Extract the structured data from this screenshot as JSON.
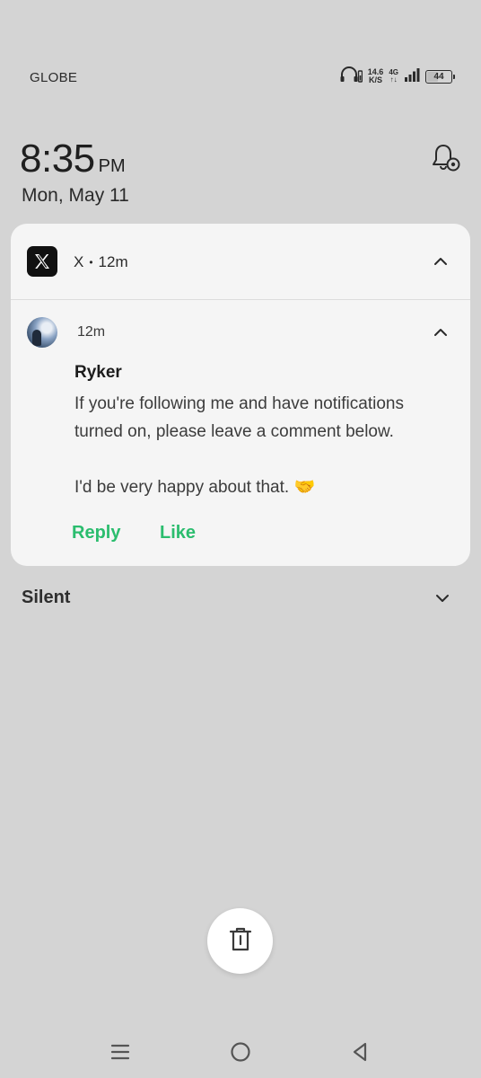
{
  "status_bar": {
    "carrier": "GLOBE",
    "net_speed_value": "14.6",
    "net_speed_unit": "K/S",
    "network_type": "4G",
    "network_activity": "↑↓",
    "battery_level": "44",
    "battery_fraction": 0.44,
    "icons": [
      "headphones-icon",
      "battery-saver-icon",
      "signal-icon",
      "battery-icon"
    ]
  },
  "lockscreen": {
    "time": "8:35",
    "ampm": "PM",
    "date": "Mon, May 11",
    "settings_icon": "notification-settings-icon"
  },
  "notification": {
    "app_name": "X",
    "separator": "•",
    "app_time": "12m",
    "message_time": "12m",
    "sender": "Ryker",
    "message_line1": "If you're following me and have notifications turned on, please leave a comment below.",
    "message_line2": "I'd be very happy about that. 🤝",
    "actions": {
      "reply": "Reply",
      "like": "Like"
    },
    "accent_color": "#2bbd6e"
  },
  "sections": {
    "silent": "Silent"
  },
  "navigation": {
    "items": [
      "menu-icon",
      "home-icon",
      "back-icon"
    ]
  }
}
